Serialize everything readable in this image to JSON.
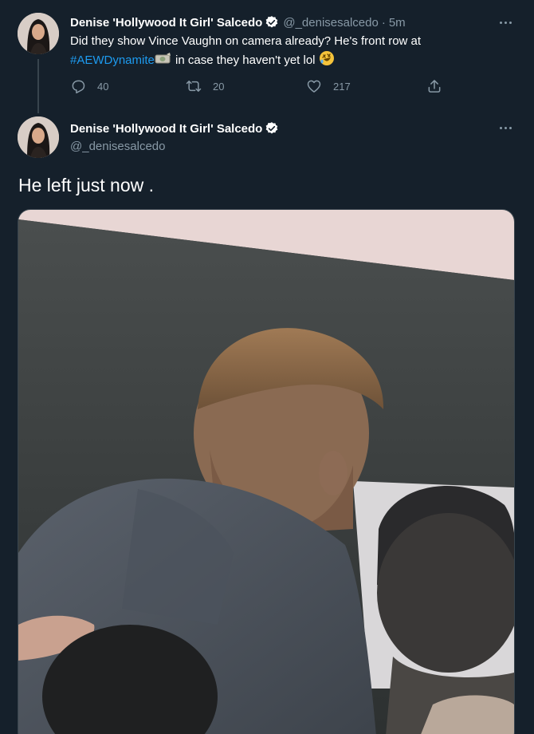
{
  "colors": {
    "background": "#15202b",
    "text_primary": "#ffffff",
    "text_secondary": "#8899a6",
    "link": "#1d9bf0",
    "verified": "#ffffff"
  },
  "tweet1": {
    "display_name": "Denise 'Hollywood It Girl' Salcedo",
    "handle": "@_denisesalcedo",
    "separator": "·",
    "time": "5m",
    "text_before": "Did they show Vince Vaughn on camera already? He's front row at ",
    "hashtag": "#AEWDynamite",
    "text_after": " in case they haven't yet lol ",
    "emoji_1": "money-bag-emoji",
    "emoji_2": "rofl-emoji",
    "actions": {
      "reply_icon": "reply-icon",
      "reply_count": "40",
      "retweet_icon": "retweet-icon",
      "retweet_count": "20",
      "like_icon": "heart-icon",
      "like_count": "217",
      "share_icon": "share-icon"
    },
    "more_icon": "more-icon"
  },
  "tweet2": {
    "display_name": "Denise 'Hollywood It Girl' Salcedo",
    "handle": "@_denisesalcedo",
    "text": "He left just now .",
    "more_icon": "more-icon",
    "photo": "attached-photo"
  }
}
